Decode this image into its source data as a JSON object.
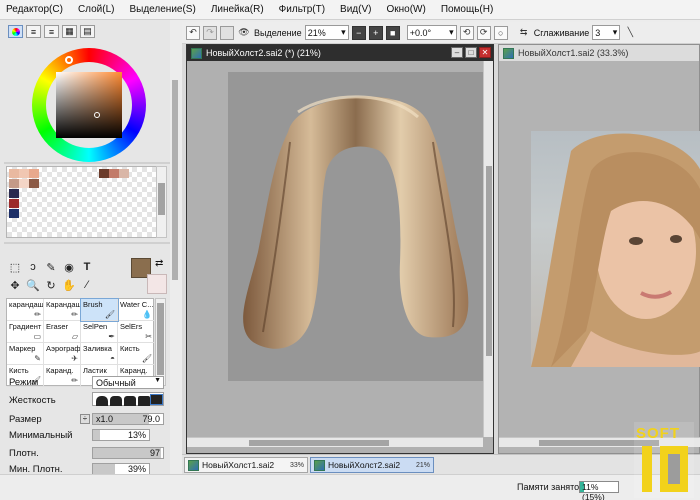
{
  "menu": [
    "Редактор(C)",
    "Слой(L)",
    "Выделение(S)",
    "Линейка(R)",
    "Фильтр(T)",
    "Вид(V)",
    "Окно(W)",
    "Помощь(H)"
  ],
  "toolbar": {
    "selection_label": "Выделение",
    "zoom": "21%",
    "rotation": "+0.0°",
    "smoothing_label": "Сглаживание",
    "smoothing_value": "3"
  },
  "swatch_colors": [
    "#e9b9a0",
    "#f1c7b2",
    "#e8a98d",
    "#6b3b2a",
    "#c27b69",
    "#d9b6a7",
    "#c49a88",
    "#f4d5c6",
    "#8b5a46",
    "#2a2a4f",
    "#9c2b2b",
    "#1d2f67"
  ],
  "colors": {
    "foreground": "#8a6e4e",
    "background": "#f3e6e6",
    "accent": "#cbdcf3"
  },
  "brushes": [
    {
      "label": "карандаш",
      "icon": "pencil-icon"
    },
    {
      "label": "Карандаш квадрат",
      "icon": "pencil-icon"
    },
    {
      "label": "Brush",
      "icon": "brush-icon",
      "selected": true
    },
    {
      "label": "Water C...",
      "icon": "water-icon"
    },
    {
      "label": "Градиент",
      "icon": "gradient-icon"
    },
    {
      "label": "Eraser",
      "icon": "eraser-icon"
    },
    {
      "label": "SelPen",
      "icon": "selpen-icon"
    },
    {
      "label": "SelErs",
      "icon": "selers-icon"
    },
    {
      "label": "Маркер",
      "icon": "marker-icon"
    },
    {
      "label": "Аэрограф",
      "icon": "airbrush-icon"
    },
    {
      "label": "Заливка",
      "icon": "bucket-icon"
    },
    {
      "label": "Кисть",
      "icon": "brush-icon"
    },
    {
      "label": "Кисть",
      "icon": "brush-icon"
    },
    {
      "label": "Каранд.",
      "icon": "pencil-icon"
    },
    {
      "label": "Ластик",
      "icon": "eraser-icon"
    },
    {
      "label": "Каранд.",
      "icon": "pencil-icon"
    }
  ],
  "props": {
    "mode_label": "Режим",
    "mode_value": "Обычный",
    "hardness_label": "Жесткость",
    "size_label": "Размер",
    "size_multiplier": "x1.0",
    "size_value": "79.0",
    "min_label": "Минимальный",
    "min_value": "13%",
    "density_label": "Плотн.",
    "density_value": "97",
    "min_density_label": "Мин. Плотн.",
    "min_density_value": "39%"
  },
  "windows": [
    {
      "title": "НовыйХолст2.sai2 (*) (21%)",
      "active": true
    },
    {
      "title": "НовыйХолст1.sai2 (33.3%)",
      "active": false
    }
  ],
  "file_tabs": [
    {
      "name": "НовыйХолст1.sai2",
      "zoom": "33%"
    },
    {
      "name": "НовыйХолст2.sai2",
      "zoom": "21%",
      "active": true
    }
  ],
  "status": {
    "memory_label": "Памяти занято",
    "memory_value": "11% (15%)",
    "memory_fraction": 0.11
  },
  "watermark": "SOFT 10"
}
